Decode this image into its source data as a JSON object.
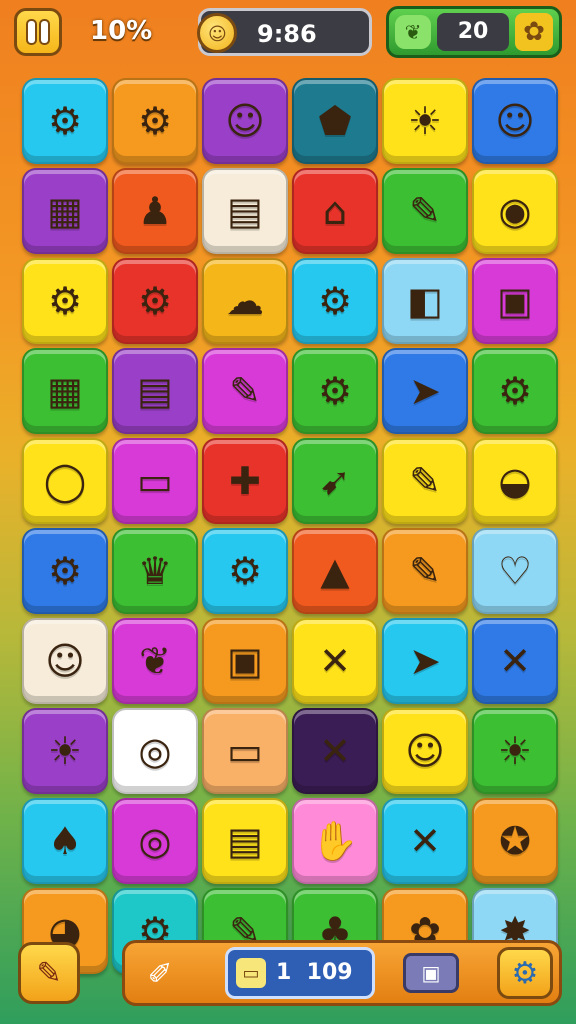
{
  "hud": {
    "progress_label": "10%",
    "timer_value": "9:86",
    "score_value": "20"
  },
  "bottom": {
    "counter_prefix": "1",
    "counter_value": "109"
  },
  "colors": {
    "cyan": "#27c8ef",
    "orange": "#f59a1e",
    "purple": "#9a3fc7",
    "teal": "#1e7a8f",
    "yellow": "#ffe21a",
    "blue": "#2f7ae6",
    "red": "#e8332a",
    "cream": "#f6ecd9",
    "green": "#3cbf33",
    "magenta": "#d83ad8",
    "lightblue": "#8fd8f5",
    "pink": "#ff8ad8",
    "peach": "#f9b067",
    "darkpurple": "#3b1d55",
    "lime": "#7fd23a"
  },
  "tiles": [
    {
      "icon": "gear-bird-icon",
      "glyph": "⚙",
      "bg": "#27c8ef"
    },
    {
      "icon": "blue-gear-face-icon",
      "glyph": "⚙",
      "bg": "#f59a1e"
    },
    {
      "icon": "sun-face-icon",
      "glyph": "☺",
      "bg": "#9a3fc7"
    },
    {
      "icon": "wooden-shield-icon",
      "glyph": "⬟",
      "bg": "#1e7a8f"
    },
    {
      "icon": "sun-icon",
      "glyph": "☀",
      "bg": "#ffe21a"
    },
    {
      "icon": "smiley-icon",
      "glyph": "☺",
      "bg": "#2f7ae6"
    },
    {
      "icon": "building-icon",
      "glyph": "▦",
      "bg": "#9a3fc7"
    },
    {
      "icon": "chef-character-icon",
      "glyph": "♟",
      "bg": "#f05a1e"
    },
    {
      "icon": "green-note-icon",
      "glyph": "▤",
      "bg": "#f6ecd9"
    },
    {
      "icon": "shop-icon",
      "glyph": "⌂",
      "bg": "#e8332a"
    },
    {
      "icon": "pencil-icon",
      "glyph": "✎",
      "bg": "#3cbf33"
    },
    {
      "icon": "lantern-icon",
      "glyph": "◉",
      "bg": "#ffe21a"
    },
    {
      "icon": "orange-gear-icon",
      "glyph": "⚙",
      "bg": "#ffe21a"
    },
    {
      "icon": "green-gear-icon",
      "glyph": "⚙",
      "bg": "#e8332a"
    },
    {
      "icon": "cloud-icon",
      "glyph": "☁",
      "bg": "#f5b61a"
    },
    {
      "icon": "blue-gear-icon",
      "glyph": "⚙",
      "bg": "#27c8ef"
    },
    {
      "icon": "document-icon",
      "glyph": "◧",
      "bg": "#8fd8f5"
    },
    {
      "icon": "clipboard-icon",
      "glyph": "▣",
      "bg": "#d83ad8"
    },
    {
      "icon": "house-icon",
      "glyph": "▦",
      "bg": "#3cbf33"
    },
    {
      "icon": "brick-house-icon",
      "glyph": "▤",
      "bg": "#9a3fc7"
    },
    {
      "icon": "pink-pencil-icon",
      "glyph": "✎",
      "bg": "#d83ad8"
    },
    {
      "icon": "orange-gear-icon",
      "glyph": "⚙",
      "bg": "#3cbf33"
    },
    {
      "icon": "arrowhead-icon",
      "glyph": "➤",
      "bg": "#2f7ae6"
    },
    {
      "icon": "blue-gear-icon",
      "glyph": "⚙",
      "bg": "#3cbf33"
    },
    {
      "icon": "ring-icon",
      "glyph": "◯",
      "bg": "#ffe21a"
    },
    {
      "icon": "eraser-icon",
      "glyph": "▭",
      "bg": "#d83ad8"
    },
    {
      "icon": "bone-icon",
      "glyph": "✚",
      "bg": "#e8332a"
    },
    {
      "icon": "leaf-arrow-icon",
      "glyph": "➹",
      "bg": "#3cbf33"
    },
    {
      "icon": "yellow-pencil-icon",
      "glyph": "✎",
      "bg": "#ffe21a"
    },
    {
      "icon": "burger-icon",
      "glyph": "◒",
      "bg": "#ffe21a"
    },
    {
      "icon": "red-gear-icon",
      "glyph": "⚙",
      "bg": "#2f7ae6"
    },
    {
      "icon": "crown-icon",
      "glyph": "♛",
      "bg": "#3cbf33"
    },
    {
      "icon": "purple-gear-icon",
      "glyph": "⚙",
      "bg": "#27c8ef"
    },
    {
      "icon": "tent-icon",
      "glyph": "▲",
      "bg": "#f05a1e"
    },
    {
      "icon": "pencil-icon",
      "glyph": "✎",
      "bg": "#f59a1e"
    },
    {
      "icon": "heart-note-icon",
      "glyph": "♡",
      "bg": "#8fd8f5"
    },
    {
      "icon": "chef-face-icon",
      "glyph": "☺",
      "bg": "#f6ecd9"
    },
    {
      "icon": "leaf-icon",
      "glyph": "❦",
      "bg": "#d83ad8"
    },
    {
      "icon": "gift-camera-icon",
      "glyph": "▣",
      "bg": "#f59a1e"
    },
    {
      "icon": "crossed-tools-icon",
      "glyph": "✕",
      "bg": "#ffe21a"
    },
    {
      "icon": "yellow-arrow-icon",
      "glyph": "➤",
      "bg": "#27c8ef"
    },
    {
      "icon": "crossed-pencils-icon",
      "glyph": "✕",
      "bg": "#2f7ae6"
    },
    {
      "icon": "sun-face-icon",
      "glyph": "☀",
      "bg": "#9a3fc7"
    },
    {
      "icon": "medal-icon",
      "glyph": "◎",
      "bg": "#ffffff"
    },
    {
      "icon": "ticket-icon",
      "glyph": "▭",
      "bg": "#f9b067"
    },
    {
      "icon": "rolling-pin-icon",
      "glyph": "✕",
      "bg": "#3b1d55"
    },
    {
      "icon": "potato-face-icon",
      "glyph": "☺",
      "bg": "#ffe21a"
    },
    {
      "icon": "yellow-sun-icon",
      "glyph": "☀",
      "bg": "#3cbf33"
    },
    {
      "icon": "droplet-character-icon",
      "glyph": "♠",
      "bg": "#27c8ef"
    },
    {
      "icon": "round-mirror-icon",
      "glyph": "◎",
      "bg": "#d83ad8"
    },
    {
      "icon": "paper-box-icon",
      "glyph": "▤",
      "bg": "#ffe21a"
    },
    {
      "icon": "glove-icon",
      "glyph": "✋",
      "bg": "#ff8ad8"
    },
    {
      "icon": "crossed-brushes-icon",
      "glyph": "✕",
      "bg": "#27c8ef"
    },
    {
      "icon": "star-badge-icon",
      "glyph": "✪",
      "bg": "#f59a1e"
    },
    {
      "icon": "globe-pencil-icon",
      "glyph": "◕",
      "bg": "#f59a1e"
    },
    {
      "icon": "gear-face-icon",
      "glyph": "⚙",
      "bg": "#1ec8c8"
    },
    {
      "icon": "paint-tool-icon",
      "glyph": "✎",
      "bg": "#3cbf33"
    },
    {
      "icon": "mushroom-icon",
      "glyph": "♣",
      "bg": "#3cbf33"
    },
    {
      "icon": "pink-gear-icon",
      "glyph": "✿",
      "bg": "#f59a1e"
    },
    {
      "icon": "star-burst-icon",
      "glyph": "✸",
      "bg": "#8fd8f5"
    }
  ]
}
